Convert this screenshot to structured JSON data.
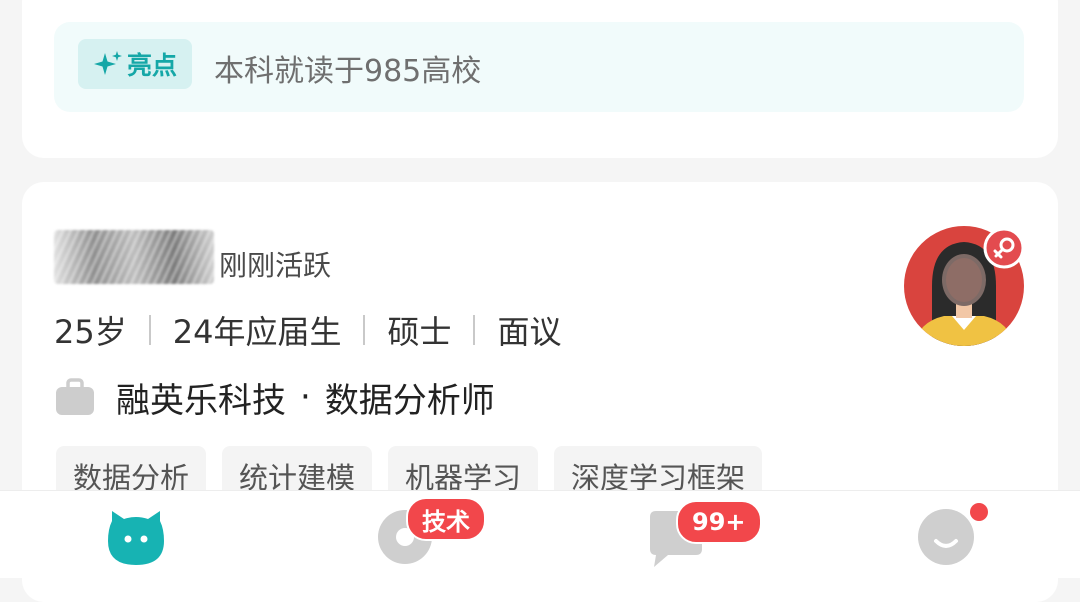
{
  "highlight": {
    "tag_label": "亮点",
    "text": "本科就读于985高校"
  },
  "candidate": {
    "active_status": "刚刚活跃",
    "info": [
      "25岁",
      "24年应届生",
      "硕士",
      "面议"
    ],
    "company": "融英乐科技",
    "separator": "·",
    "position": "数据分析师",
    "tags": [
      "数据分析",
      "统计建模",
      "机器学习",
      "深度学习框架"
    ]
  },
  "tabbar": {
    "items": [
      {
        "icon": "home-mascot-icon",
        "active": true
      },
      {
        "icon": "discover-icon",
        "badge": "技术"
      },
      {
        "icon": "message-icon",
        "badge": "99+"
      },
      {
        "icon": "profile-icon",
        "dot": true
      }
    ]
  },
  "colors": {
    "accent": "#15a7a7",
    "badge": "#f2474b",
    "tab_inactive": "#cfcfcf"
  }
}
